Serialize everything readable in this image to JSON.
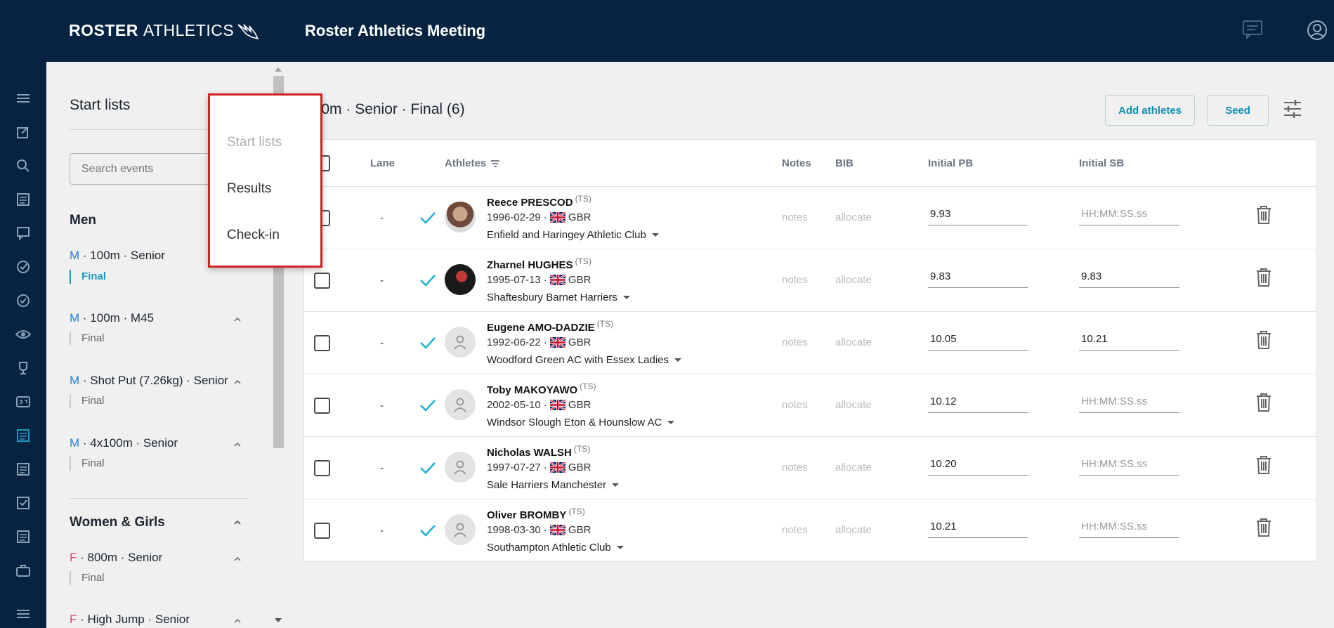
{
  "header": {
    "logo_bold": "ROSTER",
    "logo_light": "ATHLETICS",
    "meeting_title": "Roster Athletics Meeting"
  },
  "side_panel": {
    "title": "Start lists",
    "search_placeholder": "Search events",
    "groups": [
      {
        "title": "Men",
        "events": [
          {
            "sex": "M",
            "name": " · 100m · Senior",
            "round": "Final",
            "active": true
          },
          {
            "sex": "M",
            "name": " · 100m · M45",
            "round": "Final"
          },
          {
            "sex": "M",
            "name": " · Shot Put (7.26kg) · Senior",
            "round": "Final"
          },
          {
            "sex": "M",
            "name": " · 4x100m · Senior",
            "round": "Final"
          }
        ]
      },
      {
        "title": "Women & Girls",
        "events": [
          {
            "sex": "F",
            "name": " · 800m · Senior",
            "round": "Final"
          },
          {
            "sex": "F",
            "name": " · High Jump · Senior",
            "round": ""
          }
        ]
      }
    ]
  },
  "dropdown": {
    "items": [
      "Start lists",
      "Results",
      "Check-in"
    ]
  },
  "main": {
    "title": "100m · Senior · Final (6)",
    "add_athletes_label": "Add athletes",
    "seed_label": "Seed",
    "columns": {
      "lane": "Lane",
      "athletes": "Athletes",
      "notes": "Notes",
      "bib": "BIB",
      "initial_pb": "Initial PB",
      "initial_sb": "Initial SB"
    },
    "rows": [
      {
        "lane": "-",
        "name": "Reece PRESCOD",
        "tag": "(TS)",
        "dob": "1996-02-29 ·",
        "country": "GBR",
        "club": "Enfield and Haringey Athletic Club",
        "notes": "notes",
        "bib": "allocate",
        "pb": "9.93",
        "sb": "HH:MM:SS.ss"
      },
      {
        "lane": "-",
        "name": "Zharnel HUGHES",
        "tag": "(TS)",
        "dob": "1995-07-13 ·",
        "country": "GBR",
        "club": "Shaftesbury Barnet Harriers",
        "notes": "notes",
        "bib": "allocate",
        "pb": "9.83",
        "sb": "9.83"
      },
      {
        "lane": "-",
        "name": "Eugene AMO-DADZIE",
        "tag": "(TS)",
        "dob": "1992-06-22 ·",
        "country": "GBR",
        "club": "Woodford Green AC with Essex Ladies",
        "notes": "notes",
        "bib": "allocate",
        "pb": "10.05",
        "sb": "10.21"
      },
      {
        "lane": "-",
        "name": "Toby MAKOYAWO",
        "tag": "(TS)",
        "dob": "2002-05-10 ·",
        "country": "GBR",
        "club": "Windsor Slough Eton & Hounslow AC",
        "notes": "notes",
        "bib": "allocate",
        "pb": "10.12",
        "sb": "HH:MM:SS.ss"
      },
      {
        "lane": "-",
        "name": "Nicholas WALSH",
        "tag": "(TS)",
        "dob": "1997-07-27 ·",
        "country": "GBR",
        "club": "Sale Harriers Manchester",
        "notes": "notes",
        "bib": "allocate",
        "pb": "10.20",
        "sb": "HH:MM:SS.ss"
      },
      {
        "lane": "-",
        "name": "Oliver BROMBY",
        "tag": "(TS)",
        "dob": "1998-03-30 ·",
        "country": "GBR",
        "club": "Southampton Athletic Club",
        "notes": "notes",
        "bib": "allocate",
        "pb": "10.21",
        "sb": "HH:MM:SS.ss"
      }
    ]
  },
  "colors": {
    "navy": "#062442",
    "accent": "#1a9bbd",
    "highlight": "#d42020"
  }
}
